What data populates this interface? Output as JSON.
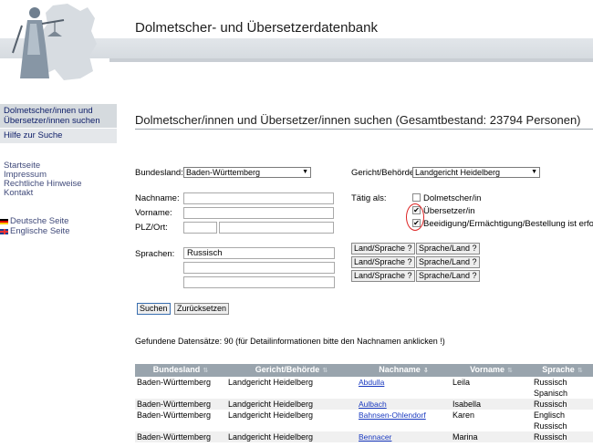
{
  "header": {
    "app_title": "Dolmetscher- und Übersetzerdatenbank"
  },
  "sidebar": {
    "active_item": "Dolmetscher/innen und Übersetzer/innen suchen",
    "help": "Hilfe zur Suche",
    "links": [
      "Startseite",
      "Impressum",
      "Rechtliche Hinweise",
      "Kontakt"
    ],
    "languages": [
      {
        "label": "Deutsche Seite",
        "icon": "flag-de-icon"
      },
      {
        "label": "Englische Seite",
        "icon": "flag-uk-icon"
      }
    ]
  },
  "main": {
    "page_title": "Dolmetscher/innen und Übersetzer/innen suchen (Gesamtbestand: 23794 Personen)",
    "form": {
      "bundesland_label": "Bundesland:",
      "bundesland_value": "Baden-Württemberg",
      "gericht_label": "Gericht/Behörde:",
      "gericht_value": "Landgericht Heidelberg",
      "nachname_label": "Nachname:",
      "vorname_label": "Vorname:",
      "plz_label": "PLZ/Ort:",
      "sprachen_label": "Sprachen:",
      "sprachen_value": "Russisch",
      "taetig_label": "Tätig als:",
      "options": [
        {
          "label": "Dolmetscher/in",
          "checked": false
        },
        {
          "label": "Übersetzer/in",
          "checked": true
        },
        {
          "label": "Beeidigung/Ermächtigung/Bestellung ist erfolgt für",
          "checked": true
        }
      ],
      "land_sprache_btn": "Land/Sprache ?",
      "sprache_land_btn": "Sprache/Land ?",
      "search_btn": "Suchen",
      "reset_btn": "Zurücksetzen"
    },
    "result_note": "Gefundene Datensätze: 90 (für Detailinformationen bitte den Nachnamen anklicken !)",
    "table": {
      "headers": [
        "Bundesland",
        "Gericht/Behörde",
        "Nachname",
        "Vorname",
        "Sprache"
      ],
      "rows": [
        {
          "bundesland": "Baden-Württemberg",
          "gericht": "Landgericht Heidelberg",
          "nachname": "Abdulla",
          "vorname": "Leila",
          "sprache": "Russisch",
          "sprache2": "Spanisch"
        },
        {
          "bundesland": "Baden-Württemberg",
          "gericht": "Landgericht Heidelberg",
          "nachname": "Aulbach",
          "vorname": "Isabella",
          "sprache": "Russisch",
          "sprache2": ""
        },
        {
          "bundesland": "Baden-Württemberg",
          "gericht": "Landgericht Heidelberg",
          "nachname": "Bahnsen-Ohlendorf",
          "vorname": "Karen",
          "sprache": "Englisch",
          "sprache2": "Russisch"
        },
        {
          "bundesland": "Baden-Württemberg",
          "gericht": "Landgericht Heidelberg",
          "nachname": "Bennacer",
          "vorname": "Marina",
          "sprache": "Russisch",
          "sprache2": ""
        }
      ]
    }
  }
}
